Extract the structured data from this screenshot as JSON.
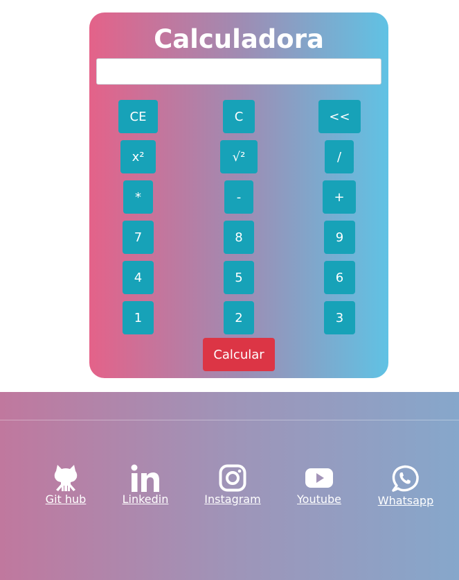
{
  "calculator": {
    "title": "Calculadora",
    "display_value": "",
    "buttons": {
      "ce": "CE",
      "c": "C",
      "backspace": "<<",
      "square": "x²",
      "sqrt": "√²",
      "divide": "/",
      "multiply": "*",
      "subtract": "-",
      "add": "+",
      "n7": "7",
      "n8": "8",
      "n9": "9",
      "n4": "4",
      "n5": "5",
      "n6": "6",
      "n1": "1",
      "n2": "2",
      "n3": "3"
    },
    "calculate_label": "Calcular"
  },
  "footer": {
    "links": [
      {
        "label": "Git hub",
        "icon": "github-icon"
      },
      {
        "label": "Linkedin",
        "icon": "linkedin-icon"
      },
      {
        "label": "Instagram",
        "icon": "instagram-icon"
      },
      {
        "label": "Youtube",
        "icon": "youtube-icon"
      },
      {
        "label": "Whatsapp",
        "icon": "whatsapp-icon"
      }
    ]
  },
  "colors": {
    "gradient_start": "#e46289",
    "gradient_end": "#60c2e4",
    "button": "#17a2b8",
    "calculate_button": "#dc3545"
  }
}
